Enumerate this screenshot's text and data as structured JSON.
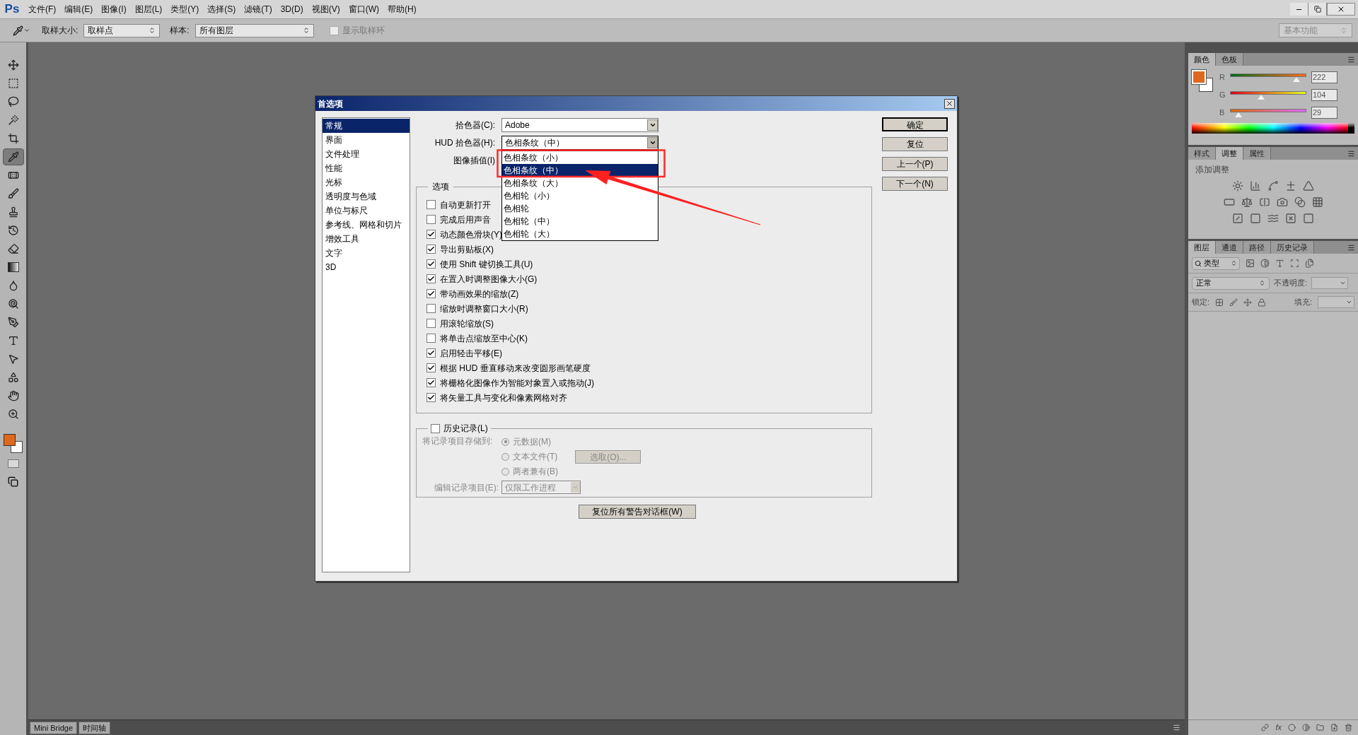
{
  "menu_bar": {
    "logo": "Ps",
    "items": [
      "文件(F)",
      "编辑(E)",
      "图像(I)",
      "图层(L)",
      "类型(Y)",
      "选择(S)",
      "滤镜(T)",
      "3D(D)",
      "视图(V)",
      "窗口(W)",
      "帮助(H)"
    ]
  },
  "options_bar": {
    "sample_size": {
      "label": "取样大小:",
      "value": "取样点"
    },
    "sample": {
      "label": "样本:",
      "value": "所有图层"
    },
    "show_ring": {
      "label": "显示取样环",
      "checked": false
    },
    "workspace": "基本功能"
  },
  "tools": [
    {
      "kind": "move",
      "selected": false
    },
    {
      "kind": "marquee",
      "selected": false
    },
    {
      "kind": "lasso",
      "selected": false
    },
    {
      "kind": "wand",
      "selected": false
    },
    {
      "kind": "crop",
      "selected": false
    },
    {
      "kind": "eyedropper",
      "selected": true
    },
    {
      "kind": "healing",
      "selected": false
    },
    {
      "kind": "brush",
      "selected": false
    },
    {
      "kind": "stamp",
      "selected": false
    },
    {
      "kind": "history",
      "selected": false
    },
    {
      "kind": "eraser",
      "selected": false
    },
    {
      "kind": "gradient",
      "selected": false
    },
    {
      "kind": "blur",
      "selected": false
    },
    {
      "kind": "dodge",
      "selected": false
    },
    {
      "kind": "pen",
      "selected": false
    },
    {
      "kind": "type",
      "selected": false
    },
    {
      "kind": "select",
      "selected": false
    },
    {
      "kind": "shape",
      "selected": false
    },
    {
      "kind": "hand",
      "selected": false
    },
    {
      "kind": "zoom",
      "selected": false
    }
  ],
  "dialog": {
    "title": "首选项",
    "nav": [
      {
        "label": "常规",
        "selected": true
      },
      {
        "label": "界面",
        "selected": false
      },
      {
        "label": "文件处理",
        "selected": false
      },
      {
        "label": "性能",
        "selected": false
      },
      {
        "label": "光标",
        "selected": false
      },
      {
        "label": "透明度与色域",
        "selected": false
      },
      {
        "label": "单位与标尺",
        "selected": false
      },
      {
        "label": "参考线、网格和切片",
        "selected": false
      },
      {
        "label": "增效工具",
        "selected": false
      },
      {
        "label": "文字",
        "selected": false
      },
      {
        "label": "3D",
        "selected": false
      }
    ],
    "fields": [
      {
        "label": "拾色器(C):",
        "value": "Adobe"
      },
      {
        "label": "HUD 拾色器(H):",
        "value": "色相条纹（中）",
        "expanded": true
      },
      {
        "label": "图像插值(I)"
      }
    ],
    "hud_options": [
      {
        "label": "色相条纹（小）",
        "selected": false
      },
      {
        "label": "色相条纹（中）",
        "selected": true
      },
      {
        "label": "色相条纹（大）",
        "selected": false
      },
      {
        "label": "色相轮（小）",
        "selected": false
      },
      {
        "label": "色相轮",
        "selected": false
      },
      {
        "label": "色相轮（中）",
        "selected": false
      },
      {
        "label": "色相轮（大）",
        "selected": false
      }
    ],
    "options_group": {
      "title": "选项",
      "items": [
        {
          "label": "自动更新打开",
          "checked": false
        },
        {
          "label": "完成后用声音",
          "checked": false
        },
        {
          "label": "动态颜色滑块(Y)",
          "checked": true
        },
        {
          "label": "导出剪贴板(X)",
          "checked": true
        },
        {
          "label": "使用 Shift 键切换工具(U)",
          "checked": true
        },
        {
          "label": "在置入时调整图像大小(G)",
          "checked": true
        },
        {
          "label": "带动画效果的缩放(Z)",
          "checked": true
        },
        {
          "label": "缩放时调整窗口大小(R)",
          "checked": false
        },
        {
          "label": "用滚轮缩放(S)",
          "checked": false
        },
        {
          "label": "将单击点缩放至中心(K)",
          "checked": false
        },
        {
          "label": "启用轻击平移(E)",
          "checked": true
        },
        {
          "label": "根据 HUD 垂直移动来改变圆形画笔硬度",
          "checked": true
        },
        {
          "label": "将栅格化图像作为智能对象置入或拖动(J)",
          "checked": true
        },
        {
          "label": "将矢量工具与变化和像素网格对齐",
          "checked": true
        }
      ]
    },
    "history": {
      "label": "历史记录(L)",
      "checked": false,
      "disabled": true,
      "store_label": "将记录项目存储到:",
      "store_options": [
        {
          "label": "元数据(M)",
          "selected": true
        },
        {
          "label": "文本文件(T)",
          "selected": false
        },
        {
          "label": "两者兼有(B)",
          "selected": false
        }
      ],
      "choose_button": "选取(O)...",
      "edit_label": "编辑记录项目(E):",
      "edit_value": "仅限工作进程"
    },
    "reset_warnings_button": "复位所有警告对话框(W)",
    "buttons": [
      {
        "label": "确定",
        "default": true
      },
      {
        "label": "复位",
        "default": false
      },
      {
        "label": "上一个(P)",
        "default": false
      },
      {
        "label": "下一个(N)",
        "default": false
      }
    ]
  },
  "color_panel": {
    "tabs": [
      {
        "label": "颜色",
        "selected": true
      },
      {
        "label": "色板",
        "selected": false
      }
    ],
    "channels": [
      {
        "name": "R",
        "level": 0.87,
        "value": "222"
      },
      {
        "name": "G",
        "level": 0.41,
        "value": "104"
      },
      {
        "name": "B",
        "level": 0.11,
        "value": "29"
      }
    ]
  },
  "adjustments_panel": {
    "tabs": [
      {
        "label": "样式",
        "selected": false
      },
      {
        "label": "调整",
        "selected": true
      },
      {
        "label": "属性",
        "selected": false
      }
    ],
    "title": "添加调整"
  },
  "layers_panel": {
    "tabs": [
      {
        "label": "图层",
        "selected": true
      },
      {
        "label": "通道",
        "selected": false
      },
      {
        "label": "路径",
        "selected": false
      },
      {
        "label": "历史记录",
        "selected": false
      }
    ],
    "filter": "类型",
    "blend_mode": "正常",
    "opacity_label": "不透明度:",
    "lock_label": "锁定:",
    "fill_label": "填充:",
    "footer_label": "fx"
  },
  "bottom_tabs": [
    "Mini Bridge",
    "时间轴"
  ]
}
